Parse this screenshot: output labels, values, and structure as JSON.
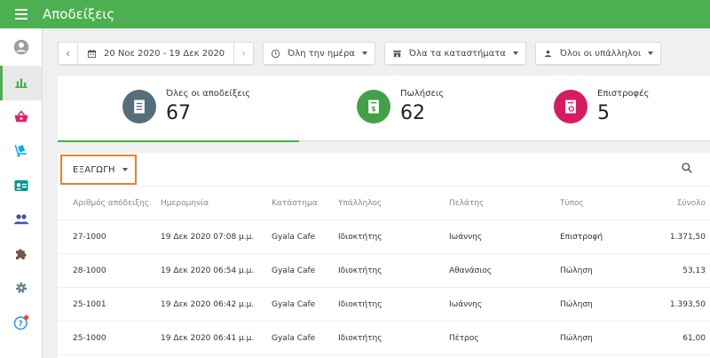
{
  "app": {
    "title": "Αποδείξεις"
  },
  "sidebar": {
    "items": [
      {
        "icon": "account-icon"
      },
      {
        "icon": "bar-chart-icon",
        "active": true
      },
      {
        "icon": "basket-icon"
      },
      {
        "icon": "dolly-icon"
      },
      {
        "icon": "id-card-icon"
      },
      {
        "icon": "people-icon"
      },
      {
        "icon": "puzzle-icon"
      },
      {
        "icon": "gear-icon"
      },
      {
        "icon": "help-icon"
      }
    ]
  },
  "filters": {
    "date_range": "20 Νοε 2020 - 19 Δεκ 2020",
    "time": "Όλη την ημέρα",
    "store": "Όλα τα καταστήματα",
    "employee": "Όλοι οι υπάλληλοι"
  },
  "stats": {
    "all": {
      "label": "Όλες οι αποδείξεις",
      "value": "67",
      "color": "#546e7a"
    },
    "sales": {
      "label": "Πωλήσεις",
      "value": "62",
      "color": "#43a047"
    },
    "refunds": {
      "label": "Επιστροφές",
      "value": "5",
      "color": "#d81b60"
    }
  },
  "toolbar": {
    "export_label": "ΕΞΑΓΩΓΗ"
  },
  "table": {
    "headers": [
      "Αριθμός απόδειξης.",
      "Ημερομηνία",
      "Κατάστημα",
      "Υπάλληλος",
      "Πελάτης",
      "Τύπος",
      "Σύνολο"
    ],
    "rows": [
      [
        "27-1000",
        "19 Δεκ 2020 07:08 μ.μ.",
        "Gyala Cafe",
        "Ιδιοκτήτης",
        "Ιωάννης",
        "Επιστροφή",
        "1.371,50"
      ],
      [
        "28-1000",
        "19 Δεκ 2020 06:54 μ.μ.",
        "Gyala Cafe",
        "Ιδιοκτήτης",
        "Αθανάσιος",
        "Πώληση",
        "53,13"
      ],
      [
        "25-1001",
        "19 Δεκ 2020 06:42 μ.μ.",
        "Gyala Cafe",
        "Ιδιοκτήτης",
        "Ιωάννης",
        "Πώληση",
        "1.393,50"
      ],
      [
        "25-1000",
        "19 Δεκ 2020 06:41 μ.μ.",
        "Gyala Cafe",
        "Ιδιοκτήτης",
        "Πέτρος",
        "Πώληση",
        "61,00"
      ]
    ]
  },
  "colors": {
    "brand": "#4caf50",
    "highlight": "#e8822f"
  }
}
